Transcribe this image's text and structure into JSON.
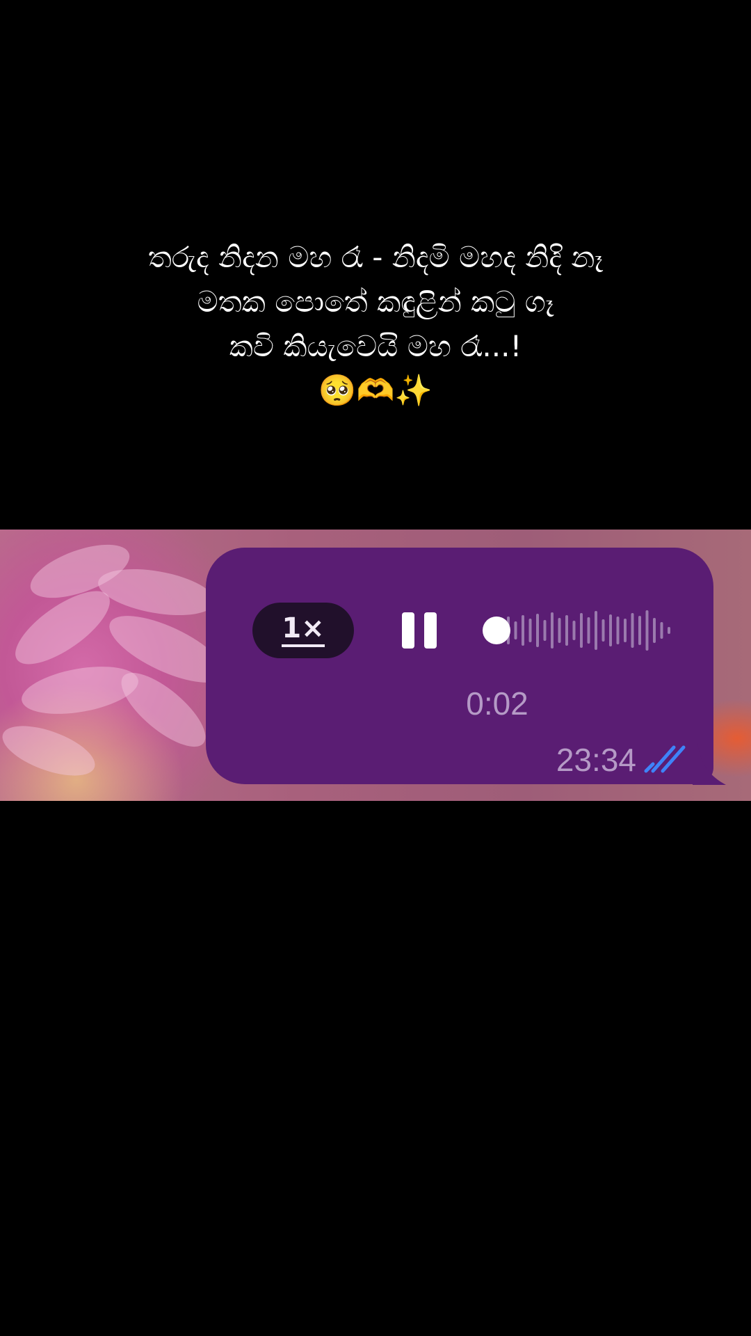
{
  "caption": {
    "line1": "තරුද නිදන මහ රෑ - නිදමි මහද නිදි නෑ",
    "line2": "මතක පොතේ කඳුළින් කටු ගෑ",
    "line3": "කවි කියැවෙයි මහ රෑ...!",
    "emoji": "🥺🫶✨"
  },
  "voice_message": {
    "speed_label": "1×",
    "duration": "0:02",
    "timestamp": "23:34",
    "playback_state": "playing",
    "progress": 0.02,
    "read_status": "read",
    "icons": {
      "pause": "pause-icon",
      "double_check": "double-check-icon"
    }
  },
  "colors": {
    "bubble": "#5a1d73",
    "speed_button_bg": "#21102b",
    "secondary_text": "#b59ac6",
    "check_marks": "#3f83f8"
  }
}
